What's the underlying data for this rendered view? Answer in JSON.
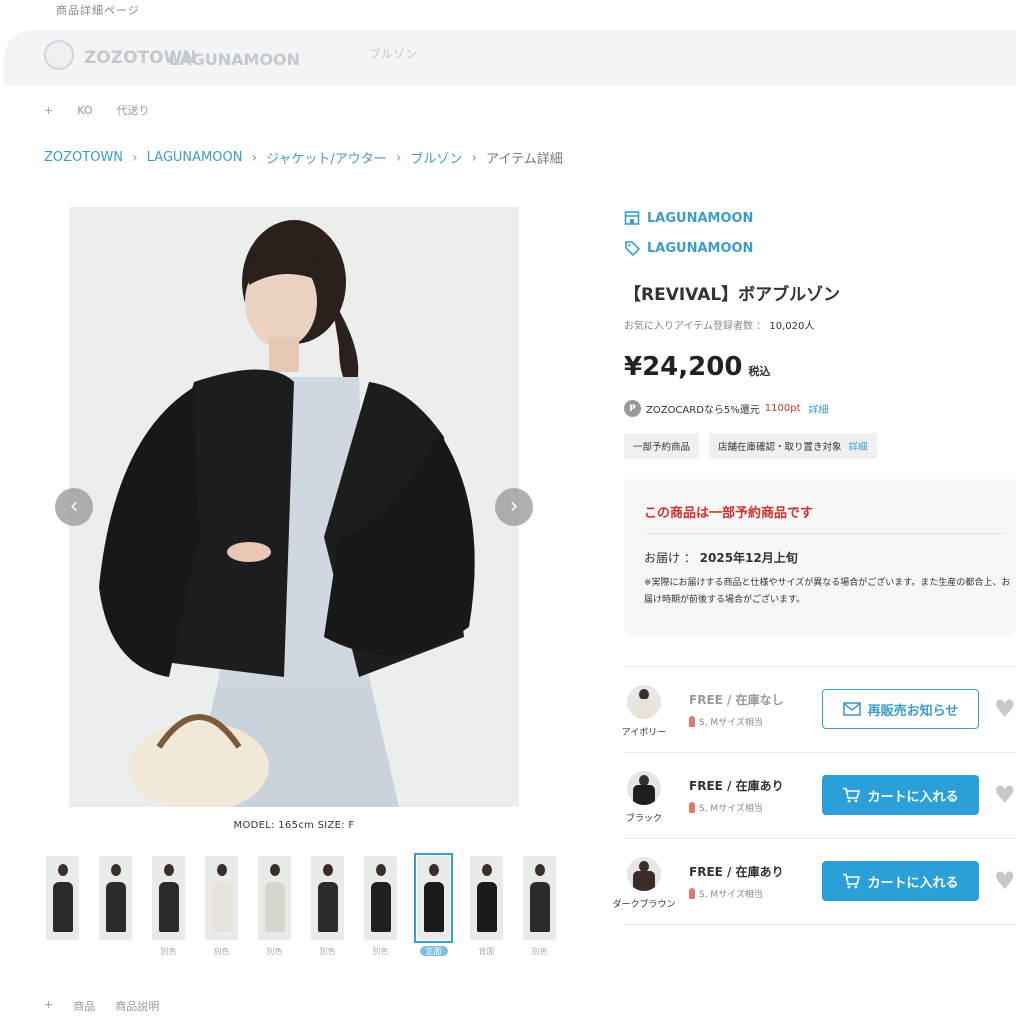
{
  "header": {
    "top_note": "商品詳細ページ",
    "faded_title_1": "ZOZOTOWN",
    "faded_title_2": "LAGUNAMOON",
    "faded_title_3": "ブルゾン",
    "sub_nav": [
      "+",
      "KO",
      "代送り"
    ]
  },
  "breadcrumb": {
    "items": [
      "ZOZOTOWN",
      "LAGUNAMOON",
      "ジャケット/アウター",
      "ブルゾン"
    ],
    "current": "アイテム詳細",
    "separator": "›"
  },
  "gallery": {
    "prev_icon": "‹",
    "next_icon": "›",
    "model_info": "MODEL: 165cm   SIZE: F",
    "thumbnails": [
      {
        "label": "",
        "color": "#2b2b2b"
      },
      {
        "label": "",
        "color": "#2b2b2b"
      },
      {
        "label": "別色",
        "color": "#2b2b2b"
      },
      {
        "label": "別色",
        "color": "#e8e4dc"
      },
      {
        "label": "別色",
        "color": "#d8d5cc"
      },
      {
        "label": "別色",
        "color": "#2b2b2b"
      },
      {
        "label": "別色",
        "color": "#1f1f1f"
      },
      {
        "label": "正面",
        "color": "#1a1a1a",
        "active": true
      },
      {
        "label": "背面",
        "color": "#1a1a1a"
      },
      {
        "label": "別色",
        "color": "#2b2b2b"
      }
    ]
  },
  "bottom_note": [
    "+",
    "商品",
    "商品説明"
  ],
  "product": {
    "brand_shop": "LAGUNAMOON",
    "brand_tag": "LAGUNAMOON",
    "title": "【REVIVAL】ボアブルゾン",
    "fav_label": "お気に入りアイテム登録者数 ：",
    "fav_count": "10,020人",
    "price": "¥24,200",
    "tax_label": "税込",
    "points_badge": "P",
    "points_text": "ZOZOCARDなら5%還元",
    "points_value": "1100pt",
    "points_link": "詳細",
    "tags": [
      "一部予約商品",
      "店舗在庫確認・取り置き対象"
    ],
    "tag_link": "詳細"
  },
  "reserve": {
    "title": "この商品は一部予約商品です",
    "delivery_label": "お届け ：",
    "delivery_value": "2025年12月上旬",
    "note": "※実際にお届けする商品と仕様やサイズが異なる場合がございます。また生産の都合上、お届け時期が前後する場合がございます。"
  },
  "variants": [
    {
      "color_name": "アイボリー",
      "stock": "FREE / 在庫なし",
      "fit": "S, Mサイズ相当",
      "button": "再販売お知らせ",
      "button_type": "notify",
      "swatch_color": "#e9e3d6"
    },
    {
      "color_name": "ブラック",
      "stock": "FREE / 在庫あり",
      "fit": "S, Mサイズ相当",
      "button": "カートに入れる",
      "button_type": "cart",
      "swatch_color": "#1e1e1e"
    },
    {
      "color_name": "ダークブラウン",
      "stock": "FREE / 在庫あり",
      "fit": "S, Mサイズ相当",
      "button": "カートに入れる",
      "button_type": "cart",
      "swatch_color": "#3b2e26"
    }
  ],
  "colors": {
    "link": "#3d9dc9",
    "reserve_title": "#d0312d",
    "cart_button": "#2a9fd8",
    "points": "#c0392b"
  }
}
